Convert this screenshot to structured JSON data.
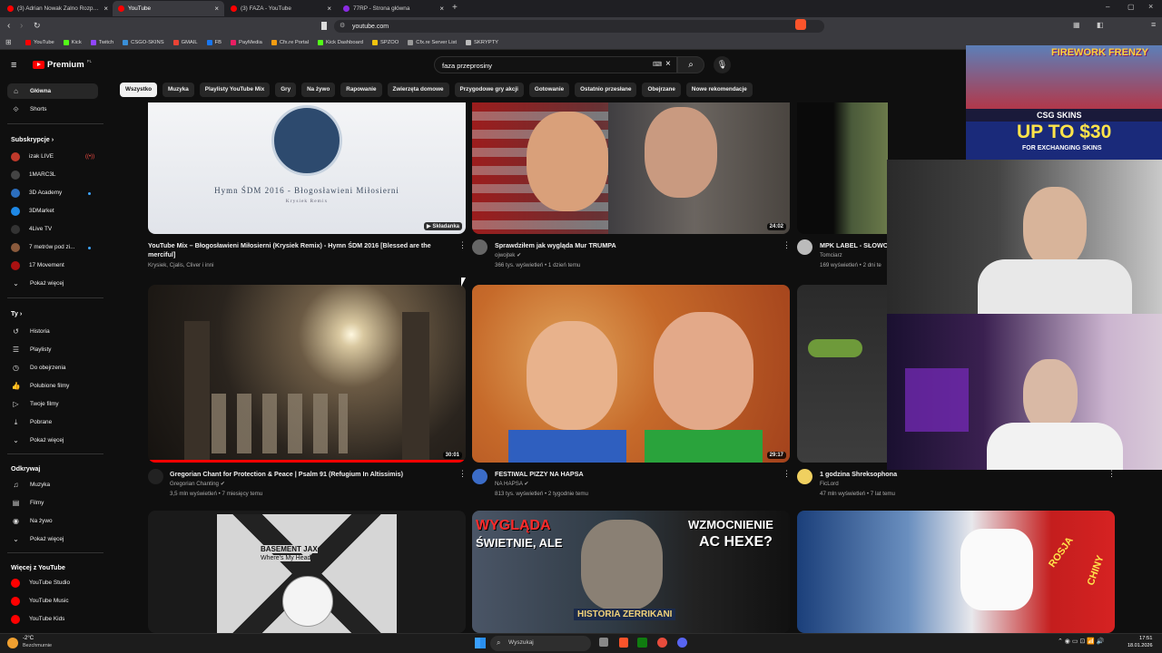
{
  "browser": {
    "tabs": [
      {
        "label": "(3) Adrian Nowak Zalno Rozpakowan",
        "color": "#ff0000"
      },
      {
        "label": "YouTube",
        "color": "#ff0000"
      },
      {
        "label": "(3) FAZA - YouTube",
        "color": "#ff0000"
      },
      {
        "label": "77RP - Strona główna",
        "color": "#8a2be2"
      }
    ],
    "url": "youtube.com",
    "bookmarks": [
      "YouTube",
      "Kick",
      "Twitch",
      "CSGO-SKINS",
      "GMAIL",
      "FB",
      "PayMedia",
      "Cfx.re Portal",
      "Kick Dashboard",
      "SPZOO",
      "Cfx.re Server List",
      "SKRYPTY"
    ]
  },
  "yt": {
    "logo": "Premium",
    "logo_sup": "PL",
    "search_query": "faza przeprosiny",
    "chips": [
      "Wszystko",
      "Muzyka",
      "Playlisty YouTube Mix",
      "Gry",
      "Na żywo",
      "Rapowanie",
      "Zwierzęta domowe",
      "Przygodowe gry akcji",
      "Gotowanie",
      "Ostatnio przesłane",
      "Obejrzane",
      "Nowe rekomendacje"
    ]
  },
  "sidebar": {
    "top": [
      {
        "label": "Główna",
        "icon": "home-icon"
      },
      {
        "label": "Shorts",
        "icon": "shorts-icon"
      }
    ],
    "subs_header": "Subskrypcje",
    "subs": [
      {
        "label": "izak LIVE",
        "color": "#c0392b"
      },
      {
        "label": "1MARC3L",
        "color": "#444"
      },
      {
        "label": "3D Academy",
        "color": "#2c6fbf"
      },
      {
        "label": "3DMarket",
        "color": "#1e88e5"
      },
      {
        "label": "4Live TV",
        "color": "#333"
      },
      {
        "label": "7 metrów pod zi...",
        "color": "#8a5a3c"
      },
      {
        "label": "17 Movement",
        "color": "#a11"
      },
      {
        "label": "Pokaż więcej",
        "color": ""
      }
    ],
    "you_header": "Ty",
    "you": [
      {
        "label": "Historia",
        "icon": "history-icon"
      },
      {
        "label": "Playlisty",
        "icon": "playlist-icon"
      },
      {
        "label": "Do obejrzenia",
        "icon": "clock-icon"
      },
      {
        "label": "Polubione filmy",
        "icon": "like-icon"
      },
      {
        "label": "Twoje filmy",
        "icon": "video-icon"
      },
      {
        "label": "Pobrane",
        "icon": "download-icon"
      },
      {
        "label": "Pokaż więcej",
        "icon": "chevron-down-icon"
      }
    ],
    "explore_header": "Odkrywaj",
    "explore": [
      {
        "label": "Muzyka",
        "icon": "music-icon"
      },
      {
        "label": "Filmy",
        "icon": "film-icon"
      },
      {
        "label": "Na żywo",
        "icon": "live-icon"
      },
      {
        "label": "Pokaż więcej",
        "icon": "chevron-down-icon"
      }
    ],
    "more_header": "Więcej z YouTube",
    "more": [
      {
        "label": "YouTube Studio"
      },
      {
        "label": "YouTube Music"
      },
      {
        "label": "YouTube Kids"
      }
    ]
  },
  "videos": [
    {
      "title": "YouTube Mix – Błogosławieni Miłosierni (Krysiek Remix) - Hymn ŚDM 2016 [Blessed are the merciful]",
      "channel": "Krysiek, Cjalis, Cliver i inni",
      "meta": "",
      "badge": "Składanka",
      "thumb_text": "Hymn ŚDM 2016 - Błogosławieni Miłosierni",
      "thumb_sub": "Krysiek Remix"
    },
    {
      "title": "Sprawdziłem jak wygląda Mur TRUMPA",
      "channel": "ojwojtek",
      "meta": "366 tys. wyświetleń • 1 dzień temu",
      "badge": "24:02"
    },
    {
      "title": "MPK LABEL - SŁOWO",
      "channel": "Tomciarz",
      "meta": "169 wyświetleń • 2 dni te",
      "badge": ""
    },
    {
      "title": "Gregorian Chant for Protection & Peace | Psalm 91 (Refugium In Altissimis)",
      "channel": "Gregorian Chanting",
      "meta": "3,5 mln wyświetleń • 7 miesięcy temu",
      "badge": "30:01"
    },
    {
      "title": "FESTIWAL PIZZY NA HAPSA",
      "channel": "NA HAPSA",
      "meta": "813 tys. wyświetleń • 2 tygodnie temu",
      "badge": "29:17"
    },
    {
      "title": "1 godzina Shreksophona",
      "channel": "FicLord",
      "meta": "47 mln wyświetleń • 7 lat temu",
      "badge": ""
    },
    {
      "thumb_a": "BASEMENT JAX",
      "thumb_b": "Where's My Head"
    },
    {
      "thumb_a": "WYGLĄDA",
      "thumb_b": "ŚWIETNIE, ALE",
      "thumb_c": "WZMOCNIENIE",
      "thumb_d": "AC HEXE?",
      "thumb_e": "HISTORIA ZERRIKANI"
    },
    {
      "thumb_a": "ROSJA",
      "thumb_b": "CHINY"
    }
  ],
  "ad": {
    "game": "FIREWORK FRENZY",
    "brand": "CSG SKINS",
    "headline": "UP TO $30",
    "sub": "FOR EXCHANGING SKINS"
  },
  "taskbar": {
    "weather_temp": "-2°C",
    "weather_label": "Bezchmurnie",
    "search": "Wyszukaj",
    "time": "17:51",
    "date": "18.01.2026"
  }
}
